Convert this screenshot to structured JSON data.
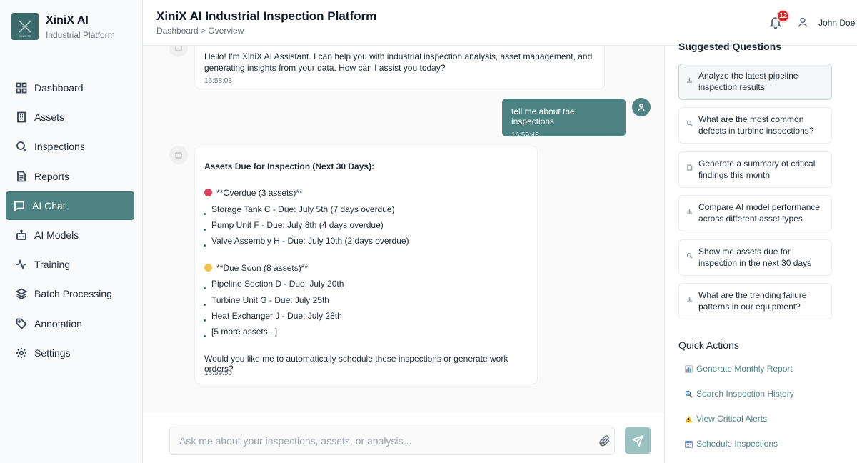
{
  "brand": {
    "name": "XiniX AI",
    "subtitle": "Industrial Platform",
    "logo_caption": "XINIX.TS"
  },
  "sidebar": {
    "items": [
      {
        "label": "Dashboard",
        "icon": "grid-icon"
      },
      {
        "label": "Assets",
        "icon": "building-icon"
      },
      {
        "label": "Inspections",
        "icon": "search-icon"
      },
      {
        "label": "Reports",
        "icon": "document-icon"
      },
      {
        "label": "AI Chat",
        "icon": "chat-icon",
        "active": true
      },
      {
        "label": "AI Models",
        "icon": "robot-icon"
      },
      {
        "label": "Training",
        "icon": "activity-icon"
      },
      {
        "label": "Batch Processing",
        "icon": "layers-icon"
      },
      {
        "label": "Annotation",
        "icon": "tag-icon"
      },
      {
        "label": "Settings",
        "icon": "gear-icon"
      }
    ]
  },
  "header": {
    "title": "XiniX AI Industrial Inspection Platform",
    "breadcrumb": "Dashboard > Overview",
    "notification_count": "12",
    "user_name": "John Doe"
  },
  "chat": {
    "messages": [
      {
        "role": "assistant",
        "text": "Hello! I'm XiniX AI Assistant. I can help you with industrial inspection analysis, asset management, and generating insights from your data. How can I assist you today?",
        "time": "16:58:08"
      },
      {
        "role": "user",
        "text": "tell me about the inspections",
        "time": "16:59:48"
      },
      {
        "role": "assistant",
        "heading": "Assets Due for Inspection (Next 30 Days):",
        "overdue_title": "**Overdue (3 assets)**",
        "overdue_color": "#d9415a",
        "overdue_items": [
          "Storage Tank C - Due: July 5th (7 days overdue)",
          "Pump Unit F - Due: July 8th (4 days overdue)",
          "Valve Assembly H - Due: July 10th (2 days overdue)"
        ],
        "due_soon_title": "**Due Soon (8 assets)**",
        "due_soon_color": "#f2c14e",
        "due_soon_items": [
          "Pipeline Section D - Due: July 20th",
          "Turbine Unit G - Due: July 25th",
          "Heat Exchanger J - Due: July 28th",
          "[5 more assets...]"
        ],
        "closing": "Would you like me to automatically schedule these inspections or generate work orders?",
        "time": "16:59:50"
      }
    ],
    "input_placeholder": "Ask me about your inspections, assets, or analysis..."
  },
  "suggested": {
    "title": "Suggested Questions",
    "items": [
      {
        "label": "Analyze the latest pipeline inspection results",
        "icon": "bar-chart-icon"
      },
      {
        "label": "What are the most common defects in turbine inspections?",
        "icon": "search-icon"
      },
      {
        "label": "Generate a summary of critical findings this month",
        "icon": "document-icon"
      },
      {
        "label": "Compare AI model performance across different asset types",
        "icon": "bar-chart-icon"
      },
      {
        "label": "Show me assets due for inspection in the next 30 days",
        "icon": "search-icon"
      },
      {
        "label": "What are the trending failure patterns in our equipment?",
        "icon": "bar-chart-icon"
      }
    ]
  },
  "quick_actions": {
    "title": "Quick Actions",
    "items": [
      {
        "label": "Generate Monthly Report",
        "icon": "chart-icon"
      },
      {
        "label": "Search Inspection History",
        "icon": "magnifier-icon"
      },
      {
        "label": "View Critical Alerts",
        "icon": "warning-icon"
      },
      {
        "label": "Schedule Inspections",
        "icon": "calendar-icon"
      }
    ]
  },
  "colors": {
    "accent": "#4e8383",
    "accent_light": "#9cc1c1",
    "badge": "#dc2626"
  }
}
